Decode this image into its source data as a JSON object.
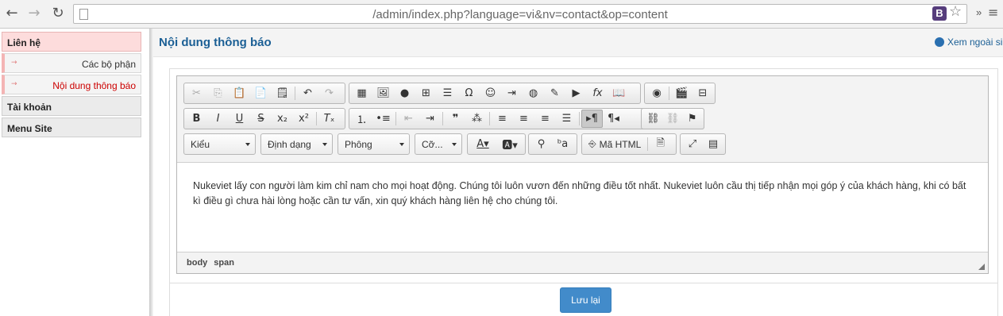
{
  "browser": {
    "url": "/admin/index.php?language=vi&nv=contact&op=content",
    "extension_label": "B",
    "more_label": "»"
  },
  "sidebar": {
    "groups": [
      {
        "label": "Liên hệ",
        "active": true
      },
      {
        "label": "Tài khoản"
      },
      {
        "label": "Menu Site"
      }
    ],
    "sub_items": [
      {
        "label": "Các bộ phận"
      },
      {
        "label": "Nội dung thông báo",
        "current": true
      }
    ],
    "arrow": "→"
  },
  "page": {
    "title": "Nội dung thông báo",
    "view_site": "Xem ngoài si"
  },
  "editor": {
    "combos": {
      "style": "Kiểu",
      "format": "Định dạng",
      "font": "Phông",
      "size": "Cỡ..."
    },
    "source_label": "Mã HTML",
    "content": "Nukeviet lấy con người làm kim chỉ nam cho mọi hoạt động. Chúng tôi luôn vươn đến những điều tốt nhất. Nukeviet luôn cầu thị tiếp nhận mọi góp ý của khách hàng, khi có bất kì điều gì chưa hài lòng hoặc cần tư vấn, xin quý khách hàng liên hệ cho chúng tôi.",
    "path": [
      "body",
      "span"
    ]
  },
  "actions": {
    "save_label": "Lưu lại"
  },
  "colors": {
    "accent": "#1b5f95",
    "button": "#428bca",
    "active_menu": "#fddcdc",
    "current_item": "#cc0000"
  }
}
